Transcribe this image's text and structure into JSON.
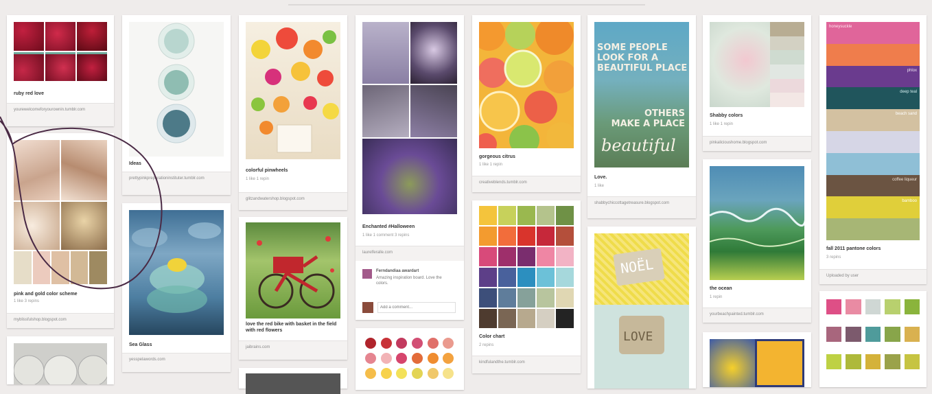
{
  "pins": [
    {
      "id": "ruby",
      "title": "ruby red love",
      "source": "yourewelcomeforyourownin.tumblr.com"
    },
    {
      "id": "pink-gold",
      "title": "pink and gold color scheme",
      "stats": "1 like  3 repins",
      "source": "myblissfulshop.blogspot.com"
    },
    {
      "id": "glitter",
      "title": "Ideas",
      "source": "prettypinkpreparationinstituter.tumblr.com"
    },
    {
      "id": "sea-glass",
      "title": "Sea Glass",
      "source": "yesspelawords.com"
    },
    {
      "id": "pompoms",
      "title": "colorful pinwheels",
      "stats": "1 like  1 repin",
      "source": "glitzandwatershop.blogspot.com"
    },
    {
      "id": "bicycle",
      "title": "love the red bike with basket in the field with red flowers",
      "source": "jaibrains.com"
    },
    {
      "id": "halloween",
      "title": "Enchanted #Halloween",
      "stats": "1 like  1 comment  3 repins",
      "source": "laurelferalle.com",
      "commenter": "Ferndandiaa awardart",
      "comment": "Amazing inspiration board. Love the colors.",
      "comment_placeholder": "Add a comment..."
    },
    {
      "id": "citrus",
      "title": "gorgeous citrus",
      "stats": "1 like  1 repin",
      "source": "creativeblends.tumblr.com"
    },
    {
      "id": "color-chart",
      "title": "Color chart",
      "stats": "2 repins",
      "source": "kindfulandthe.tumblr.com"
    },
    {
      "id": "quote",
      "title": "Love.",
      "stats": "1 like",
      "source": "shabbychiccottagetreasure.blogspot.com",
      "quote_lines": [
        "SOME PEOPLE",
        "LOOK FOR A",
        "BEAUTIFUL PLACE",
        "OTHERS",
        "MAKE A PLACE"
      ],
      "quote_script": "beautiful"
    },
    {
      "id": "noel",
      "title": "",
      "noel_word": "NOËL",
      "love_word": "LOVE"
    },
    {
      "id": "shabby",
      "title": "Shabby colors",
      "stats": "1 like  1 repin",
      "source": "pinkalicioushome.blogspot.com"
    },
    {
      "id": "ocean",
      "title": "the ocean",
      "stats": "1 repin",
      "source": "yourbeachpainted.tumblr.com"
    },
    {
      "id": "pantone",
      "title": "fall 2011 pantone colors",
      "stats": "3 repins",
      "source": "Uploaded by user",
      "palette": [
        "honeysuckle",
        "phlox",
        "deep teal",
        "beach sand",
        "coffee liqueur",
        "bamboo"
      ]
    }
  ],
  "colors": {
    "curve": "#4a2a45",
    "bg": "#efeceb"
  }
}
